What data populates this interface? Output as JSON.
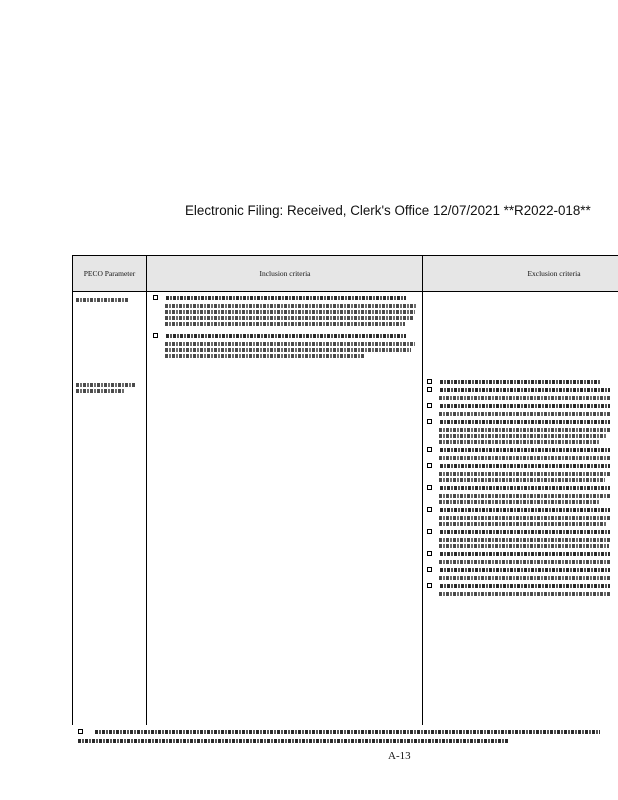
{
  "stamp": "Electronic Filing: Received, Clerk's Office 12/07/2021 **R2022-018**",
  "table": {
    "headers": {
      "parameter": "PECO Parameter",
      "inclusion": "Inclusion criteria",
      "exclusion": "Exclusion criteria"
    }
  },
  "page_number": "A-13"
}
